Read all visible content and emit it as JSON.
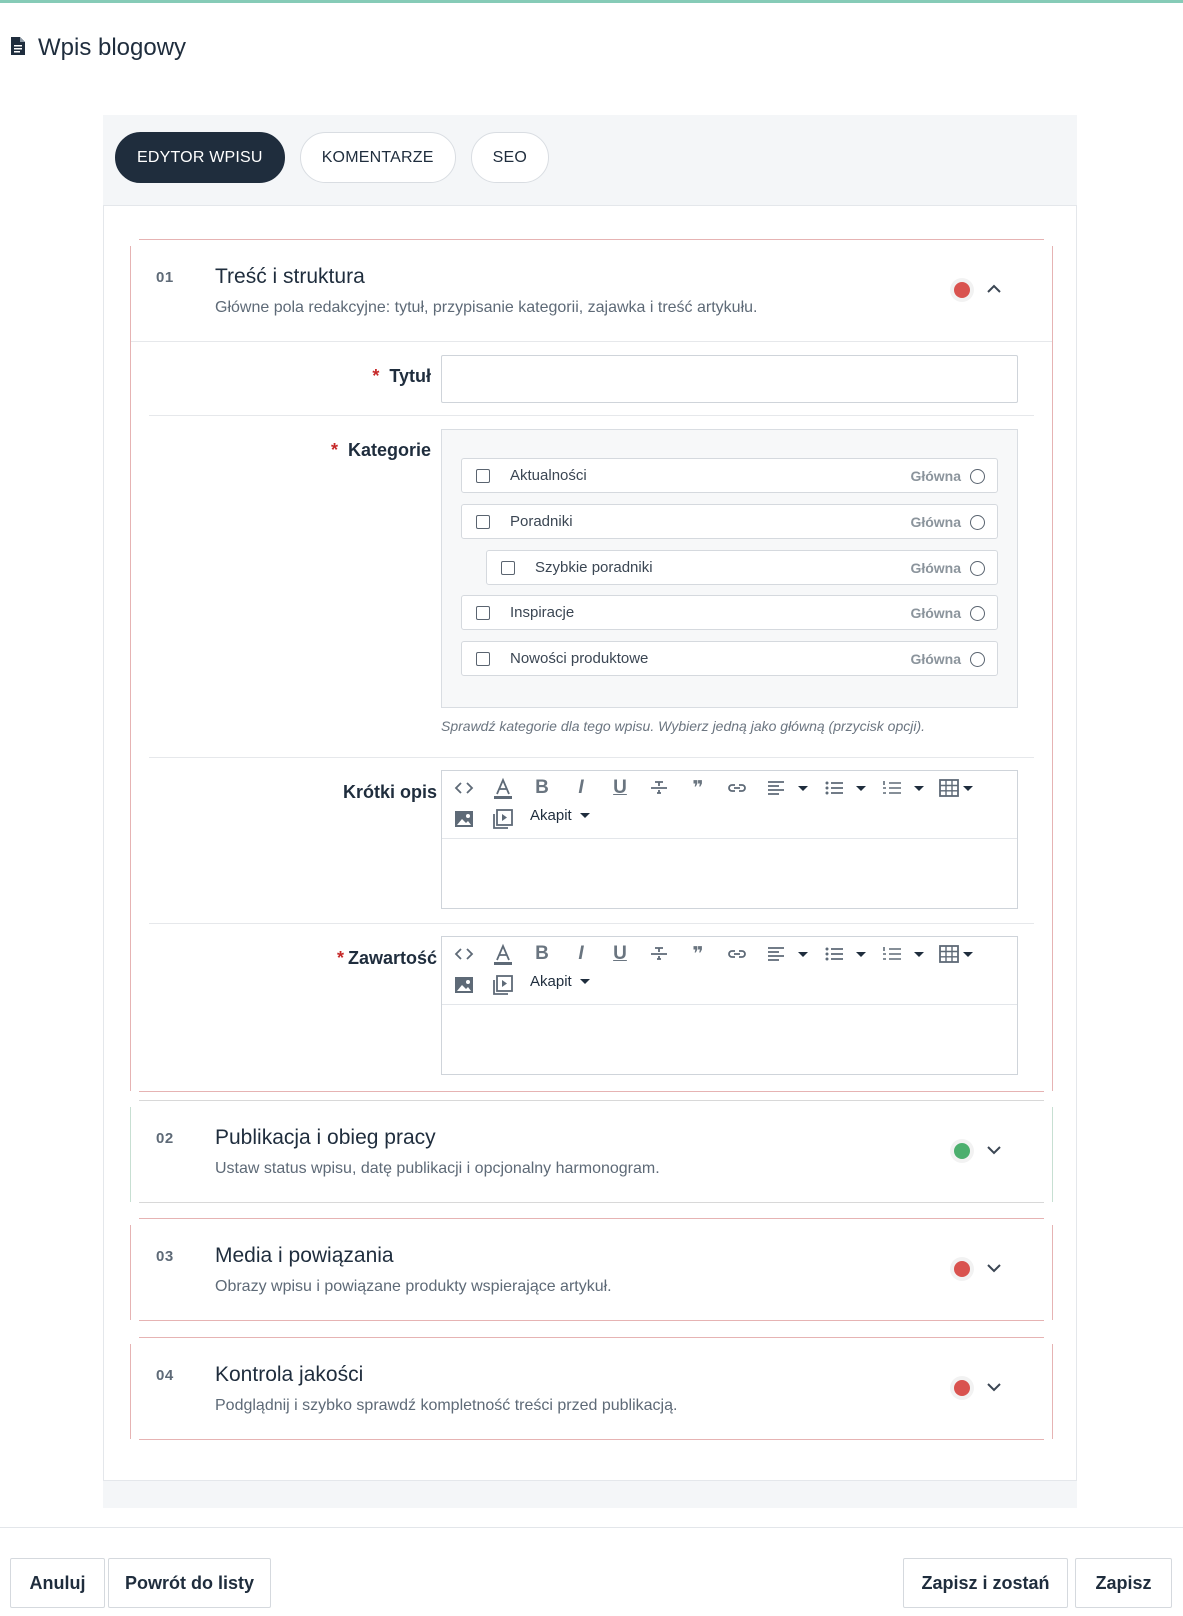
{
  "page": {
    "title": "Wpis blogowy",
    "icon": "document-icon"
  },
  "tabs": [
    {
      "label": "EDYTOR WPISU",
      "active": true
    },
    {
      "label": "KOMENTARZE",
      "active": false
    },
    {
      "label": "SEO",
      "active": false
    }
  ],
  "sections": [
    {
      "number": "01",
      "title": "Treść i struktura",
      "description": "Główne pola redakcyjne: tytuł, przypisanie kategorii, zajawka i treść artykułu.",
      "status_color": "#d9534f",
      "expanded": true
    },
    {
      "number": "02",
      "title": "Publikacja i obieg pracy",
      "description": "Ustaw status wpisu, datę publikacji i opcjonalny harmonogram.",
      "status_color": "#4caf6e",
      "expanded": false
    },
    {
      "number": "03",
      "title": "Media i powiązania",
      "description": "Obrazy wpisu i powiązane produkty wspierające artykuł.",
      "status_color": "#d9534f",
      "expanded": false
    },
    {
      "number": "04",
      "title": "Kontrola jakości",
      "description": "Podglądnij i szybko sprawdź kompletność treści przed publikacją.",
      "status_color": "#d9534f",
      "expanded": false
    }
  ],
  "form": {
    "title_field": {
      "label": "Tytuł",
      "required_mark": "*",
      "value": ""
    },
    "categories": {
      "label": "Kategorie",
      "required_mark": "*",
      "main_label": "Główna",
      "items": [
        {
          "label": "Aktualności",
          "checked": false,
          "level": 0
        },
        {
          "label": "Poradniki",
          "checked": false,
          "level": 0
        },
        {
          "label": "Szybkie poradniki",
          "checked": false,
          "level": 1
        },
        {
          "label": "Inspiracje",
          "checked": false,
          "level": 0
        },
        {
          "label": "Nowości produktowe",
          "checked": false,
          "level": 0
        }
      ],
      "hint": "Sprawdź kategorie dla tego wpisu. Wybierz jedną jako główną (przycisk opcji)."
    },
    "short_description": {
      "label": "Krótki opis",
      "paragraph_label": "Akapit"
    },
    "content": {
      "label": "Zawartość",
      "required_mark": "*",
      "paragraph_label": "Akapit"
    }
  },
  "toolbar_glyphs": {
    "bold": "B",
    "italic": "I",
    "underline": "U",
    "quote": "❞"
  },
  "footer": {
    "cancel": "Anuluj",
    "back": "Powrót do listy",
    "save_stay": "Zapisz i zostań",
    "save": "Zapisz"
  }
}
